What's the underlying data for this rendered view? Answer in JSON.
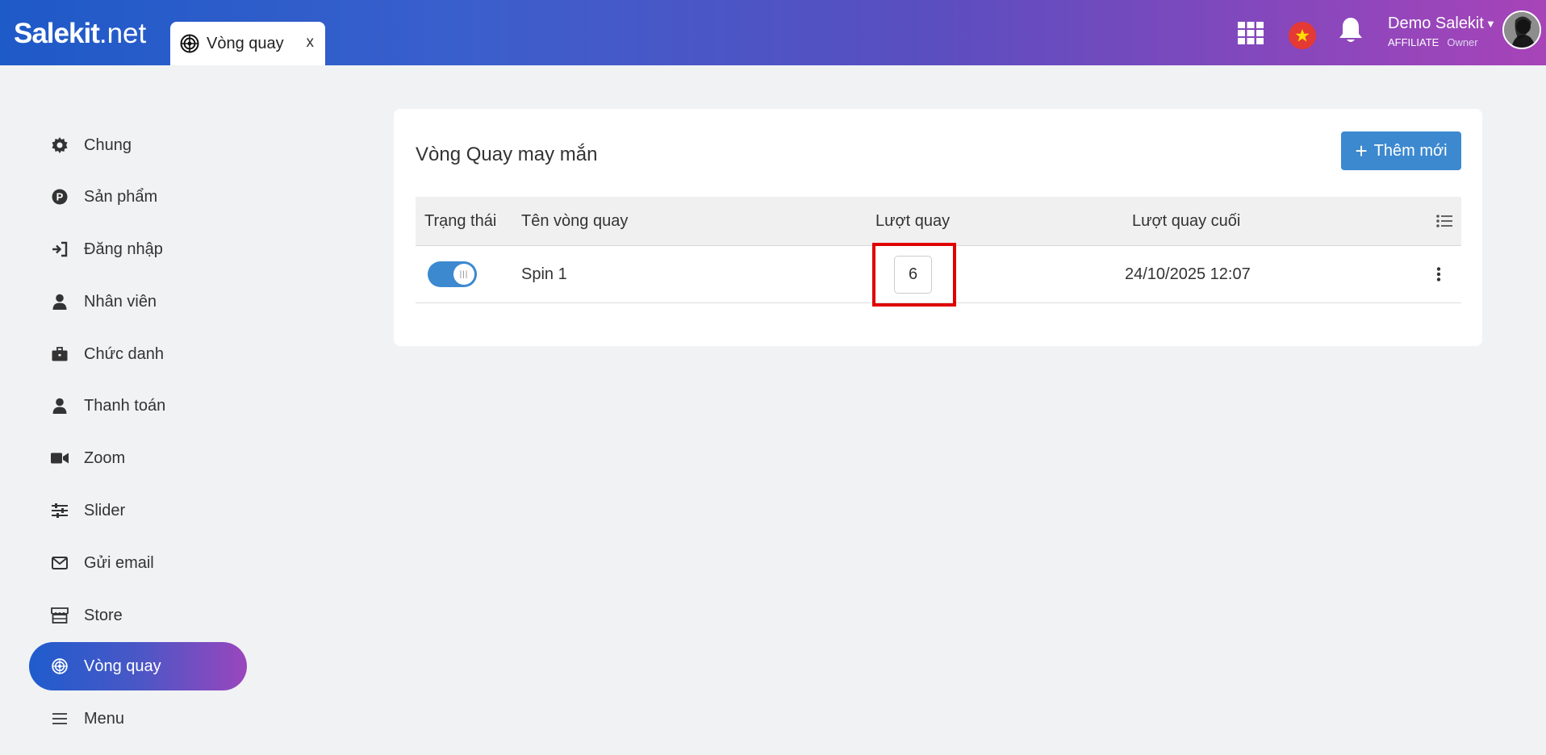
{
  "header": {
    "logo_main": "Salekit",
    "logo_suffix": ".net",
    "tab_label": "Vòng quay",
    "tab_close": "x",
    "user_name": "Demo Salekit",
    "user_type": "AFFILIATE",
    "user_role": "Owner",
    "icons": [
      "apps-grid-icon",
      "vietnam-flag-icon",
      "bell-icon",
      "caret-down-icon"
    ]
  },
  "sidebar": {
    "items": [
      {
        "label": "Chung",
        "icon": "gear-icon"
      },
      {
        "label": "Sản phẩm",
        "icon": "product-p-icon"
      },
      {
        "label": "Đăng nhập",
        "icon": "sign-in-icon"
      },
      {
        "label": "Nhân viên",
        "icon": "user-icon"
      },
      {
        "label": "Chức danh",
        "icon": "briefcase-icon"
      },
      {
        "label": "Thanh toán",
        "icon": "user-icon"
      },
      {
        "label": "Zoom",
        "icon": "video-camera-icon"
      },
      {
        "label": "Slider",
        "icon": "sliders-icon"
      },
      {
        "label": "Gửi email",
        "icon": "envelope-icon"
      },
      {
        "label": "Store",
        "icon": "store-icon"
      },
      {
        "label": "Vòng quay",
        "icon": "wheel-icon",
        "active": true
      },
      {
        "label": "Menu",
        "icon": "hamburger-icon"
      }
    ]
  },
  "main": {
    "title": "Vòng Quay may mắn",
    "add_button": "Thêm mới",
    "table": {
      "headers": [
        "Trạng thái",
        "Tên vòng quay",
        "Lượt quay",
        "Lượt quay cuối"
      ],
      "rows": [
        {
          "enabled": true,
          "name": "Spin 1",
          "spins": "6",
          "last_spin": "24/10/2025 12:07"
        }
      ]
    }
  },
  "colors": {
    "accent": "#3c89d0",
    "highlight": "#e00000",
    "header_gradient_start": "#1e5ac8",
    "header_gradient_end": "#a744b8"
  }
}
